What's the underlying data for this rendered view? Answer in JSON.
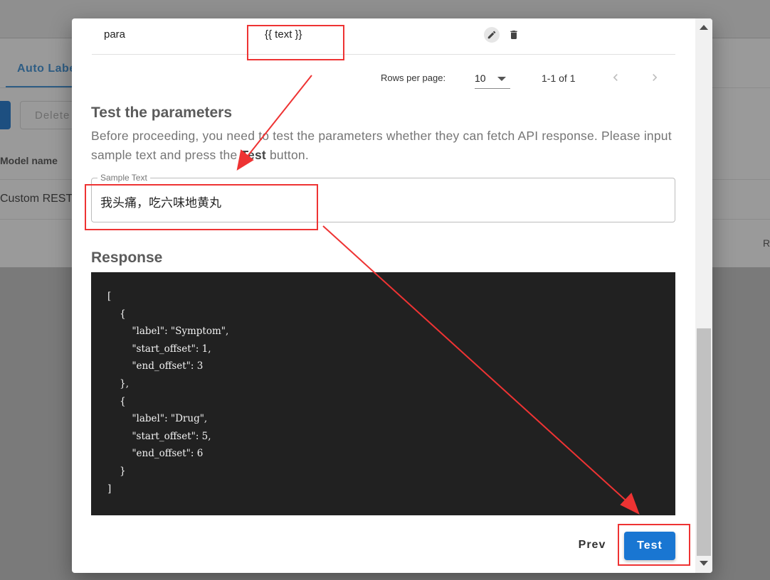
{
  "background": {
    "tab_label": "Auto Labe",
    "delete_label": "Delete",
    "column_header": "Model name",
    "row_value": "Custom REST R",
    "trailing_letter": "R"
  },
  "params_table": {
    "row": {
      "name": "para",
      "value": "{{ text }}"
    },
    "icons": {
      "edit": "pencil-icon",
      "delete": "trash-icon"
    }
  },
  "pagination": {
    "rows_per_page_label": "Rows per page:",
    "rows_per_page_value": "10",
    "range": "1-1 of 1",
    "icons": {
      "prev": "chevron-left-icon",
      "next": "chevron-right-icon"
    }
  },
  "test_section": {
    "title": "Test the parameters",
    "description_before": "Before proceeding, you need to test the parameters whether they can fetch API response. Please input sample text and press the ",
    "description_bold": "Test",
    "description_after": " button."
  },
  "sample_text": {
    "label": "Sample Text",
    "value": "我头痛，吃六味地黄丸"
  },
  "response": {
    "title": "Response",
    "body": "[\n    {\n        \"label\": \"Symptom\",\n        \"start_offset\": 1,\n        \"end_offset\": 3\n    },\n    {\n        \"label\": \"Drug\",\n        \"start_offset\": 5,\n        \"end_offset\": 6\n    }\n]"
  },
  "actions": {
    "prev_label": "Prev",
    "test_label": "Test",
    "primary_color": "#1976d2"
  },
  "annotation_color": "#ee3333"
}
